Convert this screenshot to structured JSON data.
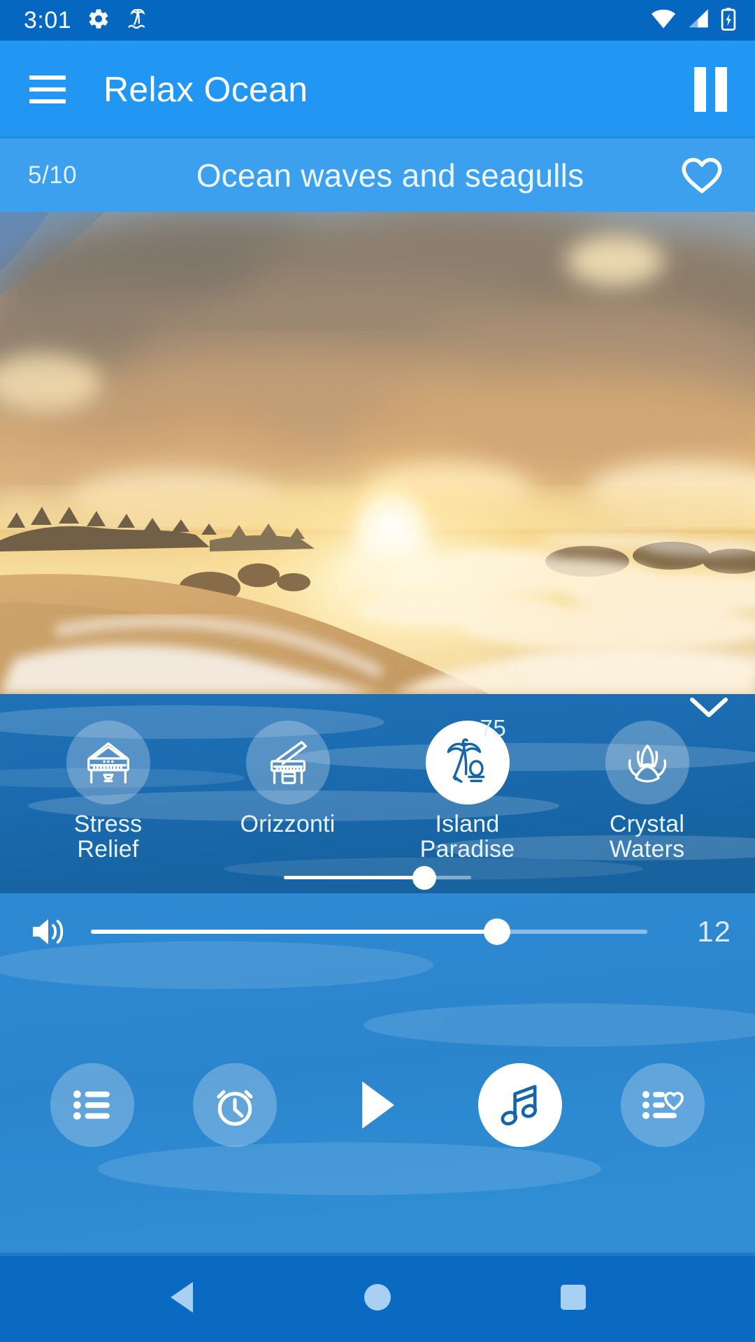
{
  "status_bar": {
    "time": "3:01",
    "left_icons": [
      "gear-icon",
      "island-palm-icon"
    ],
    "right_icons": [
      "wifi-icon",
      "cellular-signal-icon",
      "battery-charging-icon"
    ]
  },
  "app_bar": {
    "menu_icon": "hamburger-menu-icon",
    "title": "Relax Ocean",
    "playback_icon": "pause-icon"
  },
  "track_bar": {
    "index": "5/10",
    "title": "Ocean waves and seagulls",
    "favorite_icon": "heart-outline-icon",
    "favorited": false
  },
  "hero": {
    "scene": "ocean-sunset-beach-photo"
  },
  "mixer": {
    "collapse_icon": "chevron-down-icon",
    "sounds": [
      {
        "label": "Stress\nRelief",
        "label_line1": "Stress",
        "label_line2": "Relief",
        "icon": "piano-icon",
        "active": false,
        "volume": null
      },
      {
        "label": "Orizzonti",
        "label_line1": "Orizzonti",
        "label_line2": "",
        "icon": "grand-piano-icon",
        "active": false,
        "volume": null
      },
      {
        "label": "Island\nParadise",
        "label_line1": "Island",
        "label_line2": "Paradise",
        "icon": "palm-tree-island-icon",
        "active": true,
        "volume": 75,
        "volume_label": "75"
      },
      {
        "label": "Crystal\nWaters",
        "label_line1": "Crystal",
        "label_line2": "Waters",
        "icon": "lotus-flower-icon",
        "active": false,
        "volume": null
      }
    ],
    "selected_sound_volume": 75
  },
  "player": {
    "volume_icon": "speaker-volume-icon",
    "volume_value": "12",
    "volume_percent": 73,
    "controls": [
      {
        "name": "playlist-button",
        "icon": "list-icon",
        "active": false
      },
      {
        "name": "sleep-timer-button",
        "icon": "alarm-clock-icon",
        "active": false
      },
      {
        "name": "play-button",
        "icon": "play-triangle-icon",
        "active": false
      },
      {
        "name": "sounds-mixer-button",
        "icon": "music-note-icon",
        "active": true
      },
      {
        "name": "favorites-button",
        "icon": "list-heart-icon",
        "active": false
      }
    ]
  },
  "nav_bar": {
    "back_icon": "back-triangle-icon",
    "home_icon": "home-circle-icon",
    "recents_icon": "recents-square-icon"
  },
  "colors": {
    "status_bar": "#0567bf",
    "app_bar": "#2196f3",
    "track_bar": "#3ca0ee",
    "mixer_panel": "#1b6bb0",
    "player_panel": "#2b85cd",
    "nav_bar": "#0a69c1",
    "accent_white": "#ffffff",
    "icon_blue": "#1565a8"
  }
}
